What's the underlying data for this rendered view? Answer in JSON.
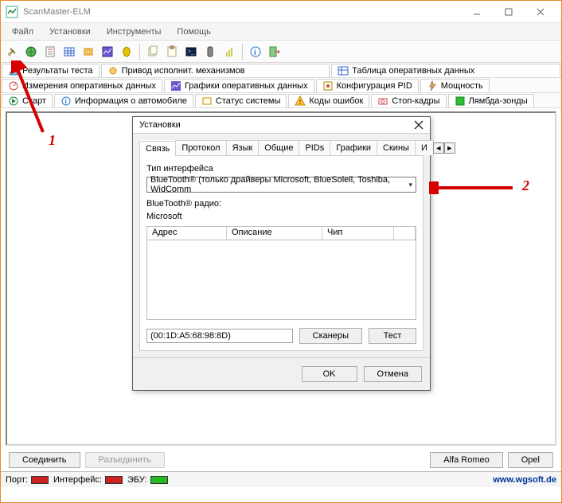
{
  "window": {
    "title": "ScanMaster-ELM"
  },
  "menu": {
    "file": "Файл",
    "setup": "Установки",
    "tools": "Инструменты",
    "help": "Помощь"
  },
  "func_tabs": {
    "results": "Результаты теста",
    "actuator": "Привод исполнит. механизмов",
    "live_table": "Таблица оперативных данных",
    "live_meas": "Измерения оперативных данных",
    "live_graphs": "Графики оперативных данных",
    "pid_conf": "Конфигурация PID",
    "power": "Мощность",
    "start": "Старт",
    "vehicle_info": "Информация о автомобиле",
    "system_status": "Статус системы",
    "dtc": "Коды ошибок",
    "freeze": "Стоп-кадры",
    "o2": "Лямбда-зонды"
  },
  "buttons": {
    "connect": "Соединить",
    "disconnect": "Разъединить",
    "alfa": "Alfa Romeo",
    "opel": "Opel"
  },
  "status": {
    "port": "Порт:",
    "iface": "Интерфейс:",
    "ecu": "ЭБУ:",
    "link": "www.wgsoft.de"
  },
  "dialog": {
    "title": "Установки",
    "tabs": {
      "conn": "Связь",
      "proto": "Протокол",
      "lang": "Язык",
      "general": "Общие",
      "pids": "PIDs",
      "graphs": "Графики",
      "skins": "Скины",
      "partial": "И"
    },
    "iface_type": "Тип интерфейса",
    "iface_value": "BlueTooth® (только драйверы Microsoft, BlueSoleil, Toshiba, WidComm",
    "radio_lbl": "BlueTooth® радио:",
    "radio_val": "Microsoft",
    "col_addr": "Адрес",
    "col_desc": "Описание",
    "col_chip": "Чип",
    "addr_field": "(00:1D:A5:68:98:8D)",
    "scanners": "Сканеры",
    "test": "Тест",
    "ok": "OK",
    "cancel": "Отмена"
  },
  "ann": {
    "one": "1",
    "two": "2"
  }
}
